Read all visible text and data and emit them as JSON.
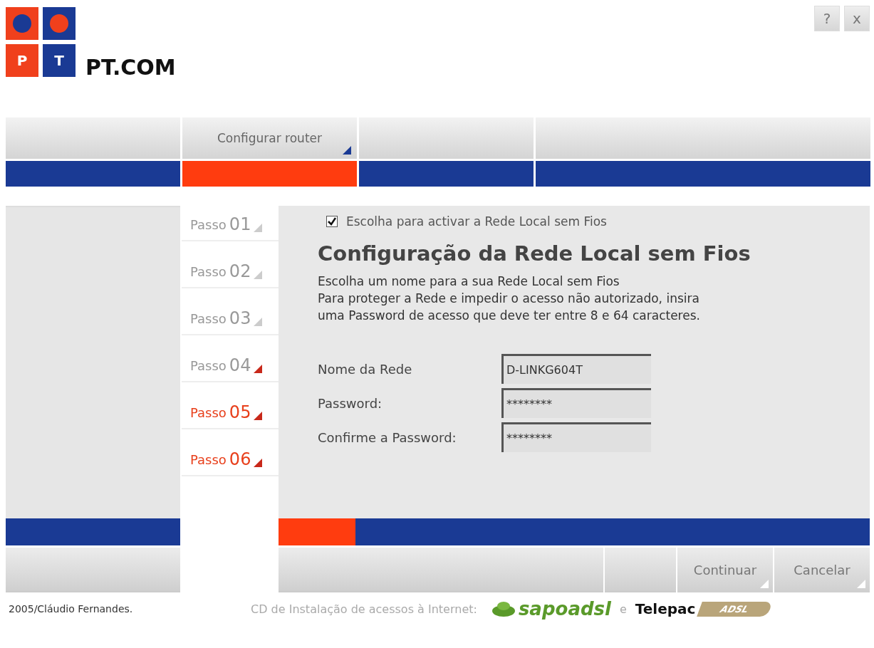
{
  "logo": {
    "tiles": [
      "P",
      "T"
    ],
    "name": "PT.COM"
  },
  "window_buttons": [
    "?",
    "x"
  ],
  "tabs": [
    {
      "selected": false
    },
    {
      "label": "Configurar router",
      "selected": true
    },
    {
      "selected": false
    },
    {
      "selected": false
    }
  ],
  "steps": [
    {
      "label": "Passo",
      "number": "01",
      "highlighted": false,
      "marker_active": false
    },
    {
      "label": "Passo",
      "number": "02",
      "highlighted": false,
      "marker_active": false
    },
    {
      "label": "Passo",
      "number": "03",
      "highlighted": false,
      "marker_active": false
    },
    {
      "label": "Passo",
      "number": "04",
      "highlighted": false,
      "marker_active": true
    },
    {
      "label": "Passo",
      "number": "05",
      "highlighted": true,
      "marker_active": true
    },
    {
      "label": "Passo",
      "number": "06",
      "highlighted": true,
      "marker_active": true
    }
  ],
  "content": {
    "checkbox": {
      "label": "Escolha para activar a Rede Local sem Fios",
      "checked": true
    },
    "title": "Configuração da Rede Local sem Fios",
    "description": [
      "Escolha um nome para a sua Rede Local sem Fios",
      "Para proteger a Rede e impedir o acesso não autorizado, insira",
      "uma Password de acesso que deve ter entre 8 e 64 caracteres."
    ],
    "fields": [
      {
        "label": "Nome da Rede",
        "value": "D-LINKG604T"
      },
      {
        "label": "Password:",
        "value": "********"
      },
      {
        "label": "Confirme a Password:",
        "value": "********"
      }
    ]
  },
  "progress": {
    "level": 0.13
  },
  "buttons": [
    "Continuar",
    "Cancelar"
  ],
  "footer": {
    "credit": "2005/Cláudio Fernandes.",
    "cd_text": "CD de Instalação de acessos à Internet:",
    "brand_1": "sapoadsl",
    "joiner": "e",
    "brand_2": "Telepac",
    "badge": "ADSL"
  }
}
